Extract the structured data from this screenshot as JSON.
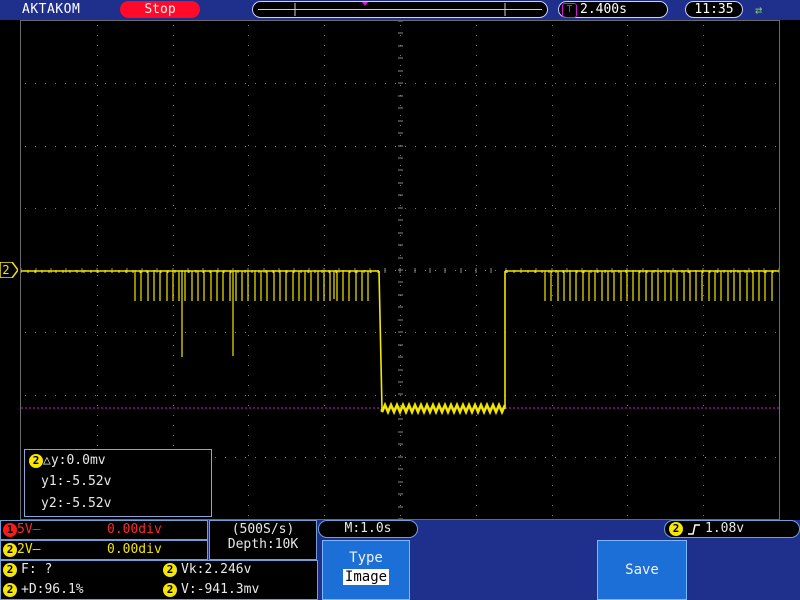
{
  "header": {
    "brand": "AKTAKOM",
    "run_state": "Stop",
    "time_position": "2.400s",
    "clock": "11:35"
  },
  "channel_marker": "2",
  "cursor_readout": {
    "channel": "2",
    "delta": "△y:0.0mv",
    "y1": "y1:-5.52v",
    "y2": "y2:-5.52v"
  },
  "channels": {
    "ch1": {
      "num": "1",
      "scale": "5V—",
      "offset": "0.00div"
    },
    "ch2": {
      "num": "2",
      "scale": "2V—",
      "offset": "0.00div"
    }
  },
  "acquisition": {
    "rate": "(500S/s)",
    "depth": "Depth:10K",
    "timebase": "M:1.0s"
  },
  "trigger": {
    "channel": "2",
    "level": "1.08v"
  },
  "measurements": {
    "channel": "2",
    "freq": "F:  ?",
    "duty": "+D:96.1%",
    "vk": "Vk:2.246v",
    "v": "V:-941.3mv"
  },
  "menu": {
    "type_label": "Type",
    "type_value": "Image",
    "save_label": "Save"
  },
  "colors": {
    "trace": "#f2e600",
    "cursor": "#d21ad2",
    "bars": "#1f2f8c",
    "stop": "#ff0a2a"
  }
}
